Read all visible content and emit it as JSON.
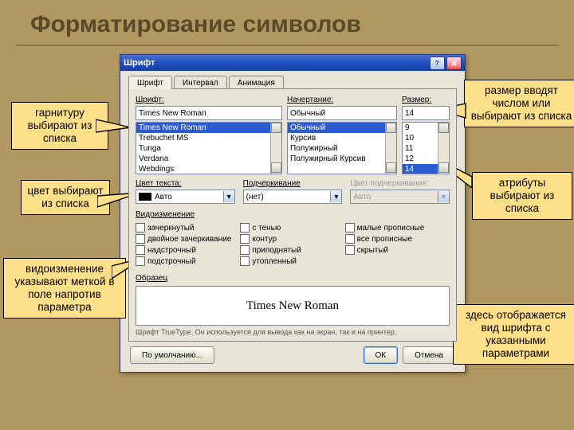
{
  "slide_title": "Форматирование символов",
  "dialog": {
    "title": "Шрифт",
    "tabs": [
      "Шрифт",
      "Интервал",
      "Анимация"
    ],
    "font_label": "Шрифт:",
    "style_label": "Начертание:",
    "size_label": "Размер:",
    "font_value": "Times New Roman",
    "style_value": "Обычный",
    "size_value": "14",
    "font_list": [
      "Times New Roman",
      "Trebuchet MS",
      "Tunga",
      "Verdana",
      "Webdings"
    ],
    "style_list": [
      "Обычный",
      "Курсив",
      "Полужирный",
      "Полужирный Курсив"
    ],
    "size_list": [
      "9",
      "10",
      "11",
      "12",
      "14"
    ],
    "color_label": "Цвет текста:",
    "color_value": "Авто",
    "under_label": "Подчеркивание",
    "under_value": "(нет)",
    "ucolor_label": "Цвет подчеркивания:",
    "ucolor_value": "Авто",
    "effects_label": "Видоизменение",
    "effects": {
      "c1": [
        "зачеркнутый",
        "двойное зачеркивание",
        "надстрочный",
        "подстрочный"
      ],
      "c2": [
        "с тенью",
        "контур",
        "приподнятый",
        "утопленный"
      ],
      "c3": [
        "малые прописные",
        "все прописные",
        "скрытый"
      ]
    },
    "preview_label": "Образец",
    "preview_text": "Times New Roman",
    "tt_hint": "Шрифт TrueType. Он используется для вывода как на экран, так и на принтер.",
    "btn_default": "По умолчанию...",
    "btn_ok": "ОК",
    "btn_cancel": "Отмена"
  },
  "callouts": {
    "c1": "гарнитуру выбирают из списка",
    "c2": "цвет выбирают из списка",
    "c3": "видоизменение указывают меткой в поле напротив параметра",
    "c4": "размер вводят числом или выбирают из списка",
    "c5": "атрибуты выбирают из списка",
    "c6": "здесь отображается вид шрифта с указанными параметрами"
  }
}
